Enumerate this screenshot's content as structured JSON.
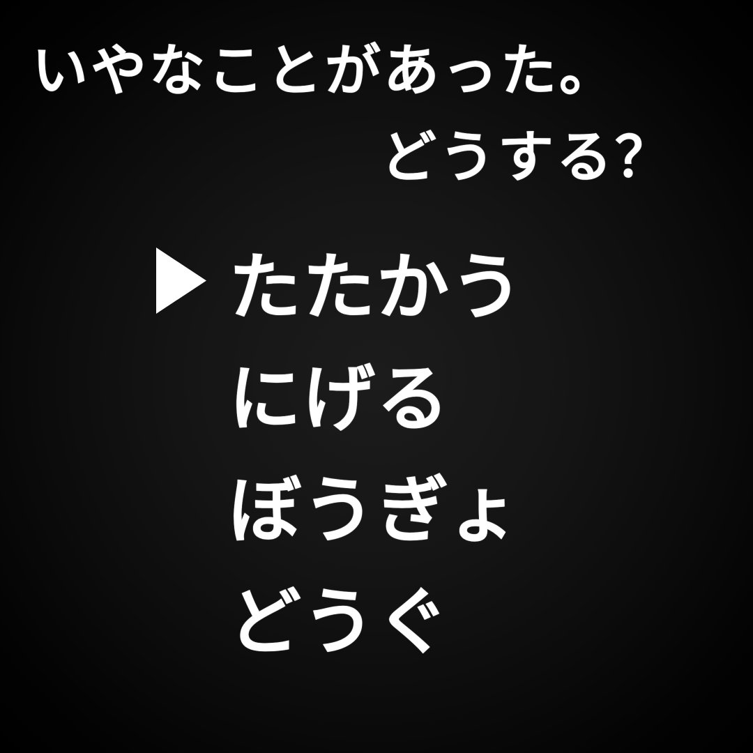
{
  "message": {
    "line1": "いやなことがあった。",
    "line2": "どうする？"
  },
  "menu": {
    "cursor_icon": "triangle-right-cursor-icon",
    "selected_index": 0,
    "items": [
      {
        "label": "たたかう"
      },
      {
        "label": "にげる"
      },
      {
        "label": "ぼうぎょ"
      },
      {
        "label": "どうぐ"
      }
    ]
  },
  "colors": {
    "background": "#000000",
    "text": "#ffffff"
  }
}
